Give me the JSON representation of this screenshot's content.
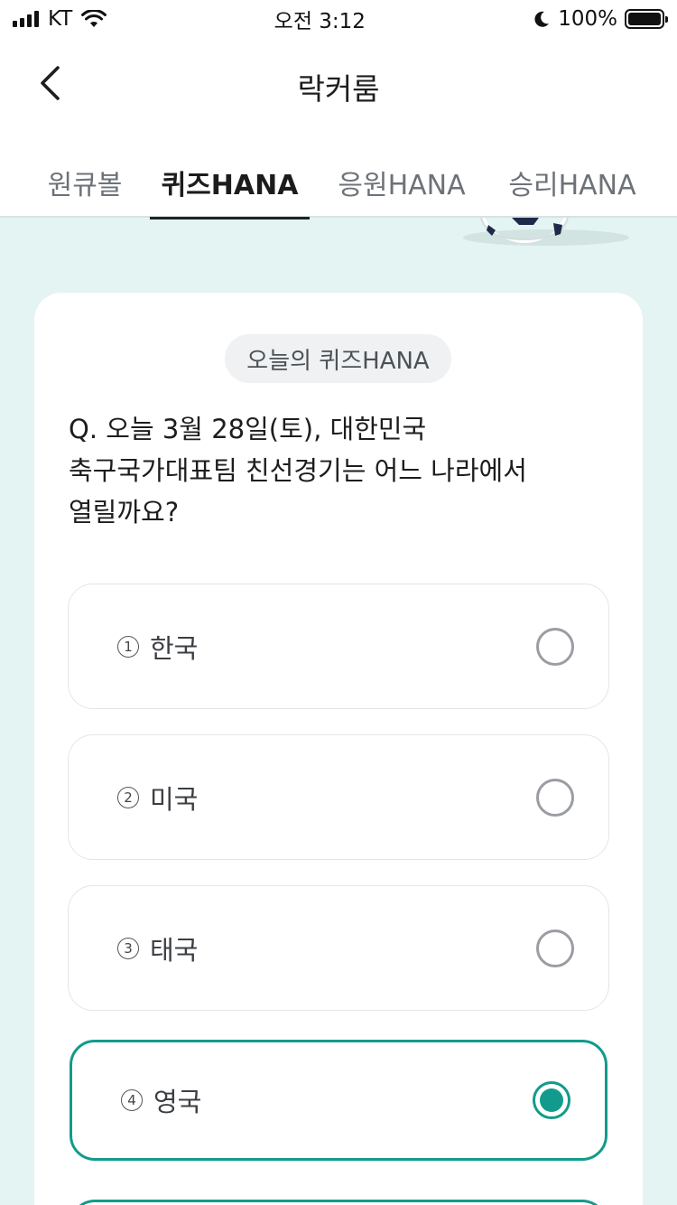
{
  "status_bar": {
    "carrier": "KT",
    "time": "오전 3:12",
    "battery": "100%"
  },
  "header": {
    "title": "락커룸",
    "back_icon": "chevron-left-icon"
  },
  "tabs": [
    {
      "label": "원큐볼",
      "active": false
    },
    {
      "label": "퀴즈HANA",
      "active": true
    },
    {
      "label": "응원HANA",
      "active": false
    },
    {
      "label": "승리HANA",
      "active": false
    }
  ],
  "quiz": {
    "badge": "오늘의 퀴즈HANA",
    "question_lines": [
      "Q. 오늘 3월 28일(토), 대한민국",
      "축구국가대표팀 친선경기는 어느 나라에서",
      "열릴까요?"
    ],
    "options": [
      {
        "num": "1",
        "label": "한국",
        "selected": false
      },
      {
        "num": "2",
        "label": "미국",
        "selected": false
      },
      {
        "num": "3",
        "label": "태국",
        "selected": false
      },
      {
        "num": "4",
        "label": "영국",
        "selected": true
      }
    ],
    "accent_color": "#129b8c"
  }
}
